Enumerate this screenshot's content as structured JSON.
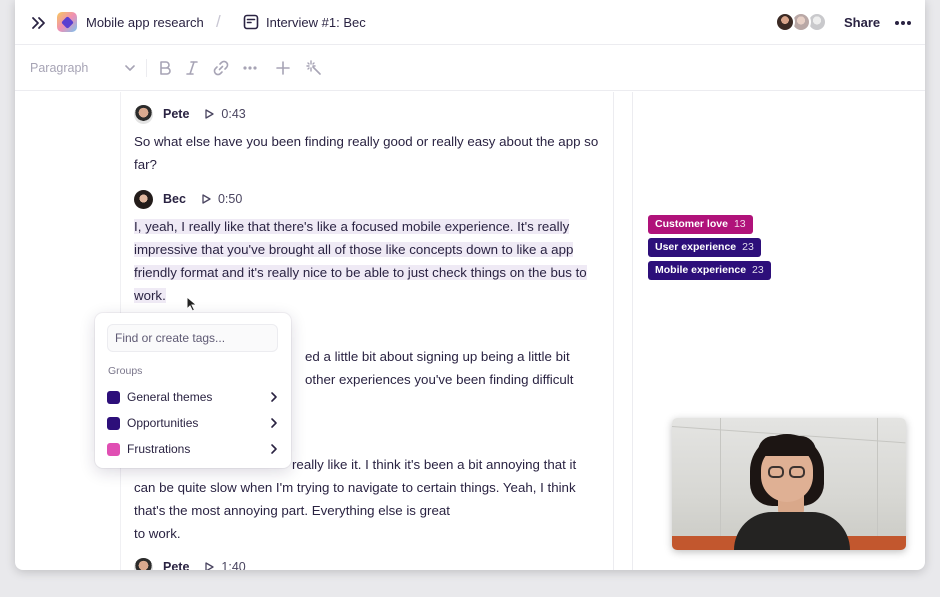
{
  "header": {
    "project_name": "Mobile app research",
    "separator": "/",
    "document_title": "Interview #1: Bec",
    "share_label": "Share"
  },
  "toolbar": {
    "paragraph_style": "Paragraph"
  },
  "transcript": [
    {
      "speaker": "Pete",
      "time": "0:43",
      "text": "So what else have you been finding really good or really easy about the app so far?"
    },
    {
      "speaker": "Bec",
      "time": "0:50",
      "text": "I, yeah, I really like that there's like a focused mobile experience. It's really impressive that you've brought all of those like concepts down to like a app friendly format and it's really nice to be able to just check things on the bus to work."
    },
    {
      "partial_text_1": "ed a little bit about signing up being a little bit",
      "partial_text_2": "other experiences you've been finding difficult"
    },
    {
      "partial_first_line": "really like it. I think it's been a bit annoying that it",
      "text_rest": "can be quite slow when I'm trying to navigate to certain things. Yeah, I think that's the most annoying part. Everything else is great",
      "text_tail": "to work."
    },
    {
      "speaker": "Pete",
      "time": "1:40"
    }
  ],
  "tags": [
    {
      "label": "Customer love",
      "count": "13",
      "color": "#b0127a"
    },
    {
      "label": "User experience",
      "count": "23",
      "color": "#2d0f7a"
    },
    {
      "label": "Mobile experience",
      "count": "23",
      "color": "#2d0f7a"
    }
  ],
  "tag_popup": {
    "placeholder": "Find or create tags...",
    "groups_label": "Groups",
    "groups": [
      {
        "label": "General themes",
        "color": "#2d0f7a"
      },
      {
        "label": "Opportunities",
        "color": "#2d0f7a"
      },
      {
        "label": "Frustrations",
        "color": "#e04fb3"
      }
    ]
  },
  "icons": {
    "expand": "double-chevron-right-icon",
    "document": "document-icon",
    "more": "more-horizontal-icon",
    "play": "play-icon",
    "bold": "bold-icon",
    "italic": "italic-icon",
    "link": "link-icon",
    "add": "plus-icon",
    "magic": "magic-wand-icon"
  }
}
